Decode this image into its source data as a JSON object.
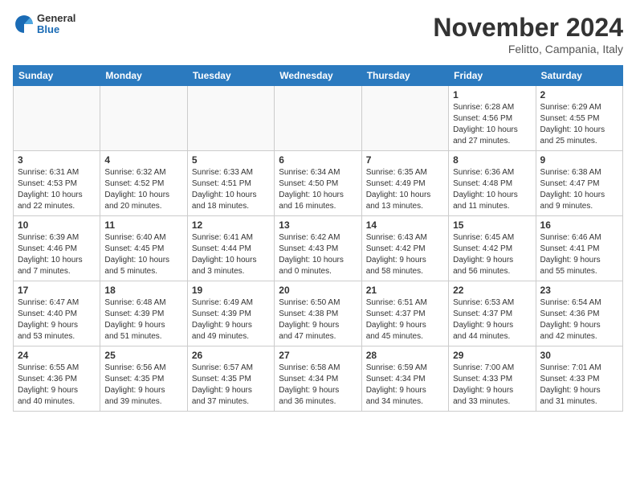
{
  "header": {
    "logo_general": "General",
    "logo_blue": "Blue",
    "month_title": "November 2024",
    "location": "Felitto, Campania, Italy"
  },
  "weekdays": [
    "Sunday",
    "Monday",
    "Tuesday",
    "Wednesday",
    "Thursday",
    "Friday",
    "Saturday"
  ],
  "weeks": [
    [
      {
        "day": "",
        "info": ""
      },
      {
        "day": "",
        "info": ""
      },
      {
        "day": "",
        "info": ""
      },
      {
        "day": "",
        "info": ""
      },
      {
        "day": "",
        "info": ""
      },
      {
        "day": "1",
        "info": "Sunrise: 6:28 AM\nSunset: 4:56 PM\nDaylight: 10 hours\nand 27 minutes."
      },
      {
        "day": "2",
        "info": "Sunrise: 6:29 AM\nSunset: 4:55 PM\nDaylight: 10 hours\nand 25 minutes."
      }
    ],
    [
      {
        "day": "3",
        "info": "Sunrise: 6:31 AM\nSunset: 4:53 PM\nDaylight: 10 hours\nand 22 minutes."
      },
      {
        "day": "4",
        "info": "Sunrise: 6:32 AM\nSunset: 4:52 PM\nDaylight: 10 hours\nand 20 minutes."
      },
      {
        "day": "5",
        "info": "Sunrise: 6:33 AM\nSunset: 4:51 PM\nDaylight: 10 hours\nand 18 minutes."
      },
      {
        "day": "6",
        "info": "Sunrise: 6:34 AM\nSunset: 4:50 PM\nDaylight: 10 hours\nand 16 minutes."
      },
      {
        "day": "7",
        "info": "Sunrise: 6:35 AM\nSunset: 4:49 PM\nDaylight: 10 hours\nand 13 minutes."
      },
      {
        "day": "8",
        "info": "Sunrise: 6:36 AM\nSunset: 4:48 PM\nDaylight: 10 hours\nand 11 minutes."
      },
      {
        "day": "9",
        "info": "Sunrise: 6:38 AM\nSunset: 4:47 PM\nDaylight: 10 hours\nand 9 minutes."
      }
    ],
    [
      {
        "day": "10",
        "info": "Sunrise: 6:39 AM\nSunset: 4:46 PM\nDaylight: 10 hours\nand 7 minutes."
      },
      {
        "day": "11",
        "info": "Sunrise: 6:40 AM\nSunset: 4:45 PM\nDaylight: 10 hours\nand 5 minutes."
      },
      {
        "day": "12",
        "info": "Sunrise: 6:41 AM\nSunset: 4:44 PM\nDaylight: 10 hours\nand 3 minutes."
      },
      {
        "day": "13",
        "info": "Sunrise: 6:42 AM\nSunset: 4:43 PM\nDaylight: 10 hours\nand 0 minutes."
      },
      {
        "day": "14",
        "info": "Sunrise: 6:43 AM\nSunset: 4:42 PM\nDaylight: 9 hours\nand 58 minutes."
      },
      {
        "day": "15",
        "info": "Sunrise: 6:45 AM\nSunset: 4:42 PM\nDaylight: 9 hours\nand 56 minutes."
      },
      {
        "day": "16",
        "info": "Sunrise: 6:46 AM\nSunset: 4:41 PM\nDaylight: 9 hours\nand 55 minutes."
      }
    ],
    [
      {
        "day": "17",
        "info": "Sunrise: 6:47 AM\nSunset: 4:40 PM\nDaylight: 9 hours\nand 53 minutes."
      },
      {
        "day": "18",
        "info": "Sunrise: 6:48 AM\nSunset: 4:39 PM\nDaylight: 9 hours\nand 51 minutes."
      },
      {
        "day": "19",
        "info": "Sunrise: 6:49 AM\nSunset: 4:39 PM\nDaylight: 9 hours\nand 49 minutes."
      },
      {
        "day": "20",
        "info": "Sunrise: 6:50 AM\nSunset: 4:38 PM\nDaylight: 9 hours\nand 47 minutes."
      },
      {
        "day": "21",
        "info": "Sunrise: 6:51 AM\nSunset: 4:37 PM\nDaylight: 9 hours\nand 45 minutes."
      },
      {
        "day": "22",
        "info": "Sunrise: 6:53 AM\nSunset: 4:37 PM\nDaylight: 9 hours\nand 44 minutes."
      },
      {
        "day": "23",
        "info": "Sunrise: 6:54 AM\nSunset: 4:36 PM\nDaylight: 9 hours\nand 42 minutes."
      }
    ],
    [
      {
        "day": "24",
        "info": "Sunrise: 6:55 AM\nSunset: 4:36 PM\nDaylight: 9 hours\nand 40 minutes."
      },
      {
        "day": "25",
        "info": "Sunrise: 6:56 AM\nSunset: 4:35 PM\nDaylight: 9 hours\nand 39 minutes."
      },
      {
        "day": "26",
        "info": "Sunrise: 6:57 AM\nSunset: 4:35 PM\nDaylight: 9 hours\nand 37 minutes."
      },
      {
        "day": "27",
        "info": "Sunrise: 6:58 AM\nSunset: 4:34 PM\nDaylight: 9 hours\nand 36 minutes."
      },
      {
        "day": "28",
        "info": "Sunrise: 6:59 AM\nSunset: 4:34 PM\nDaylight: 9 hours\nand 34 minutes."
      },
      {
        "day": "29",
        "info": "Sunrise: 7:00 AM\nSunset: 4:33 PM\nDaylight: 9 hours\nand 33 minutes."
      },
      {
        "day": "30",
        "info": "Sunrise: 7:01 AM\nSunset: 4:33 PM\nDaylight: 9 hours\nand 31 minutes."
      }
    ]
  ]
}
